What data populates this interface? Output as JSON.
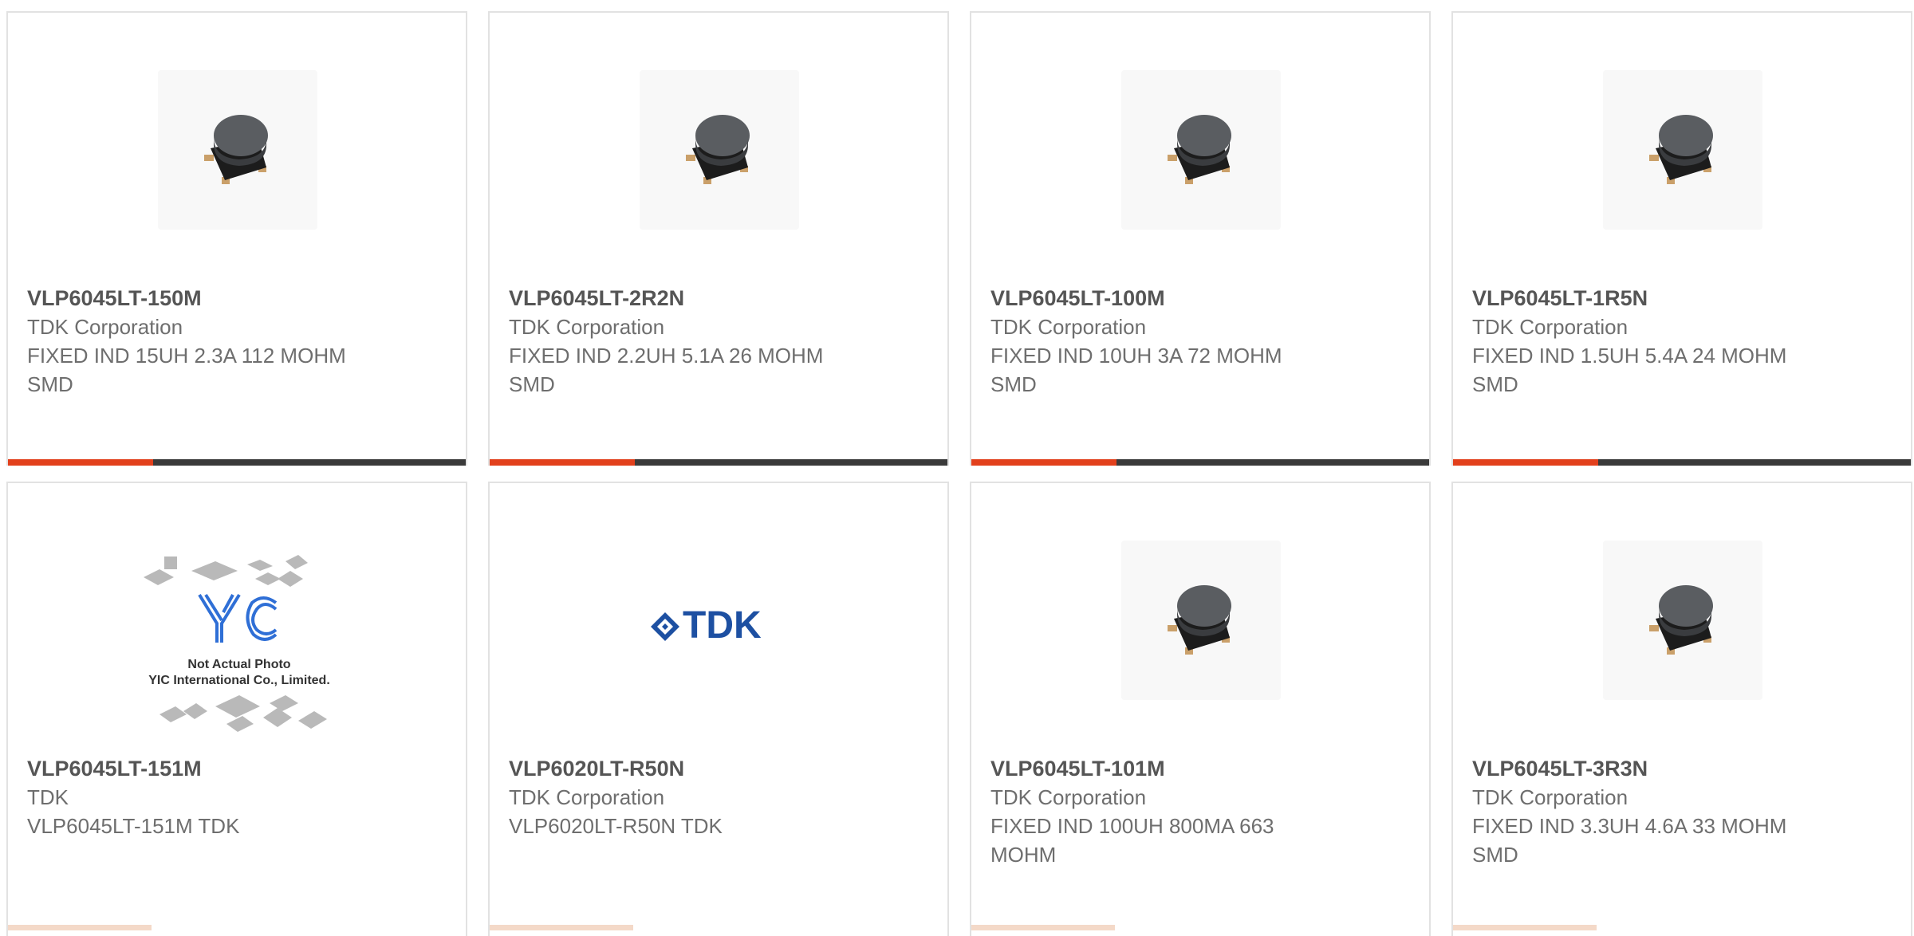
{
  "colors": {
    "accent": "#e2401c",
    "bar": "#3a3a3a",
    "border": "#e2e2e2",
    "part_number": "#555555",
    "text": "#6e6e6e"
  },
  "products": [
    {
      "part_number": "VLP6045LT-150M",
      "manufacturer": "TDK Corporation",
      "description": "FIXED IND 15UH 2.3A 112 MOHM SMD",
      "image": "inductor-photo"
    },
    {
      "part_number": "VLP6045LT-2R2N",
      "manufacturer": "TDK Corporation",
      "description": "FIXED IND 2.2UH 5.1A 26 MOHM SMD",
      "image": "inductor-photo"
    },
    {
      "part_number": "VLP6045LT-100M",
      "manufacturer": "TDK Corporation",
      "description": "FIXED IND 10UH 3A 72 MOHM SMD",
      "image": "inductor-photo"
    },
    {
      "part_number": "VLP6045LT-1R5N",
      "manufacturer": "TDK Corporation",
      "description": "FIXED IND 1.5UH 5.4A 24 MOHM SMD",
      "image": "inductor-photo"
    },
    {
      "part_number": "VLP6045LT-151M",
      "manufacturer": "TDK",
      "description": "VLP6045LT-151M TDK",
      "image": "placeholder-photo",
      "placeholder_line1": "Not Actual Photo",
      "placeholder_line2": "YIC International Co., Limited."
    },
    {
      "part_number": "VLP6020LT-R50N",
      "manufacturer": "TDK Corporation",
      "description": "VLP6020LT-R50N TDK",
      "image": "tdk-logo",
      "logo_text": "TDK"
    },
    {
      "part_number": "VLP6045LT-101M",
      "manufacturer": "TDK Corporation",
      "description": "FIXED IND 100UH 800MA 663 MOHM",
      "image": "inductor-photo"
    },
    {
      "part_number": "VLP6045LT-3R3N",
      "manufacturer": "TDK Corporation",
      "description": "FIXED IND 3.3UH 4.6A 33 MOHM SMD",
      "image": "inductor-photo"
    }
  ]
}
